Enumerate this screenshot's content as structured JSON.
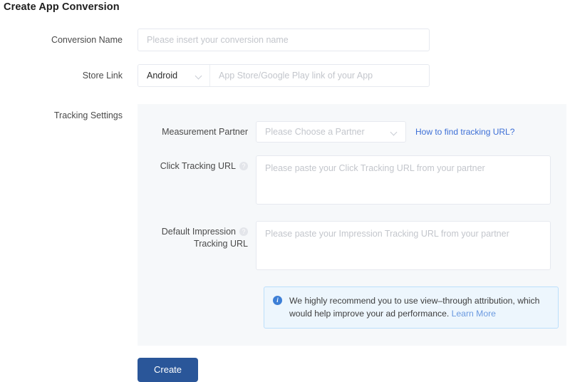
{
  "page": {
    "title": "Create App Conversion"
  },
  "form": {
    "conversion_name": {
      "label": "Conversion Name",
      "placeholder": "Please insert your conversion name",
      "value": ""
    },
    "store_link": {
      "label": "Store Link",
      "platform_value": "Android",
      "chevron_icon": "chevron-down-icon",
      "placeholder": "App Store/Google Play link of your App",
      "value": ""
    },
    "tracking_settings": {
      "label": "Tracking Settings",
      "measurement_partner": {
        "label": "Measurement Partner",
        "placeholder": "Please Choose a Partner",
        "value": "",
        "chevron_icon": "chevron-down-icon",
        "help_link": "How to find tracking URL?"
      },
      "click_tracking_url": {
        "label": "Click Tracking URL",
        "help_icon": "question-mark-icon",
        "help_glyph": "?",
        "placeholder": "Please paste your Click Tracking URL from your partner",
        "value": ""
      },
      "impression_tracking_url": {
        "label_line1": "Default Impression",
        "label_line2": "Tracking URL",
        "help_icon": "question-mark-icon",
        "help_glyph": "?",
        "placeholder": "Please paste your Impression Tracking URL from your partner",
        "value": ""
      },
      "notice": {
        "icon": "info-circle-icon",
        "icon_glyph": "i",
        "text": "We highly recommend you to use view–through attribution, which would help improve your ad performance. ",
        "link_text": "Learn More"
      }
    }
  },
  "actions": {
    "create_label": "Create"
  },
  "colors": {
    "primary_button": "#2a5699",
    "link": "#3d6fd6",
    "notice_bg": "#edf6fd",
    "notice_border": "#bcdffb",
    "panel_bg": "#f6f8fa",
    "input_border": "#e6e9ef",
    "placeholder": "#c3c6cc"
  }
}
